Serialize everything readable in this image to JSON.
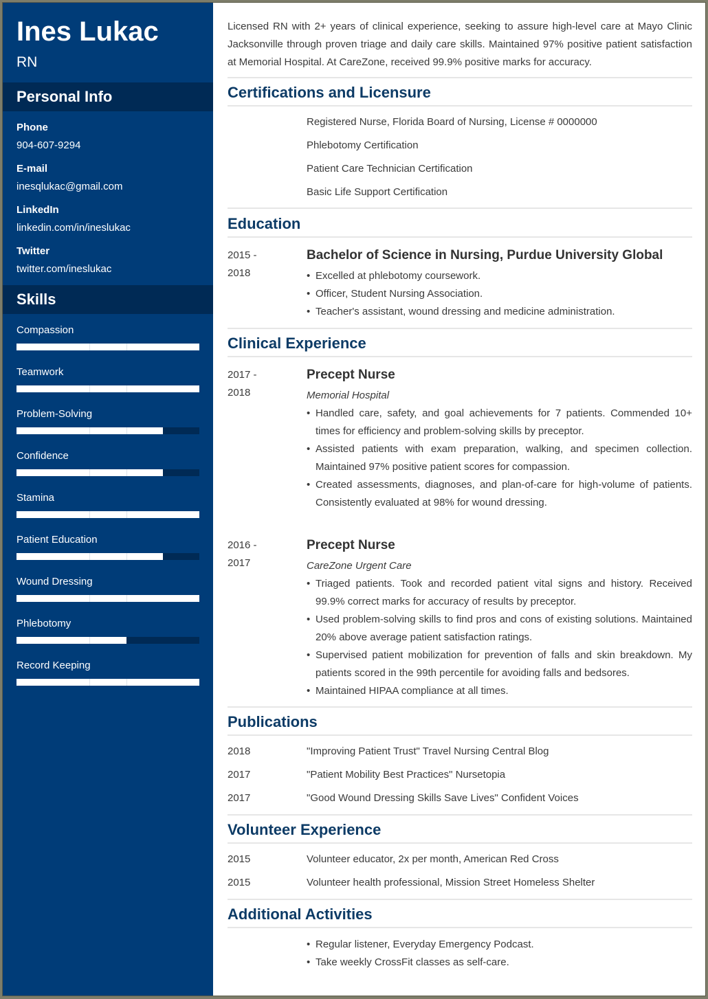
{
  "header": {
    "name": "Ines Lukac",
    "title": "RN"
  },
  "sidebar": {
    "personal_info_title": "Personal Info",
    "contacts": [
      {
        "label": "Phone",
        "value": "904-607-9294"
      },
      {
        "label": "E-mail",
        "value": "inesqlukac@gmail.com"
      },
      {
        "label": "LinkedIn",
        "value": "linkedin.com/in/ineslukac"
      },
      {
        "label": "Twitter",
        "value": "twitter.com/ineslukac"
      }
    ],
    "skills_title": "Skills",
    "skills": [
      {
        "name": "Compassion",
        "level": 1.0
      },
      {
        "name": "Teamwork",
        "level": 1.0
      },
      {
        "name": "Problem-Solving",
        "level": 0.8
      },
      {
        "name": "Confidence",
        "level": 0.8
      },
      {
        "name": "Stamina",
        "level": 1.0
      },
      {
        "name": "Patient Education",
        "level": 0.8
      },
      {
        "name": "Wound Dressing",
        "level": 1.0
      },
      {
        "name": "Phlebotomy",
        "level": 0.6
      },
      {
        "name": "Record Keeping",
        "level": 1.0
      }
    ]
  },
  "summary": "Licensed RN with 2+ years of clinical experience, seeking to assure high-level care at Mayo Clinic Jacksonville through proven triage and daily care skills. Maintained 97% positive patient satisfaction at Memorial Hospital. At CareZone, received 99.9% positive marks for accuracy.",
  "certifications": {
    "title": "Certifications and Licensure",
    "items": [
      "Registered Nurse, Florida Board of Nursing, License # 0000000",
      "Phlebotomy Certification",
      "Patient Care Technician Certification",
      "Basic Life Support Certification"
    ]
  },
  "education": {
    "title": "Education",
    "entries": [
      {
        "start": "2015 -",
        "end": "2018",
        "degree": "Bachelor of Science in Nursing, Purdue University Global",
        "bullets": [
          "Excelled at phlebotomy coursework.",
          "Officer, Student Nursing Association.",
          "Teacher's assistant, wound dressing and medicine administration."
        ]
      }
    ]
  },
  "experience": {
    "title": "Clinical Experience",
    "entries": [
      {
        "start": "2017 -",
        "end": "2018",
        "role": "Precept Nurse",
        "company": "Memorial Hospital",
        "bullets": [
          "Handled care, safety, and goal achievements for 7 patients. Commended 10+ times for efficiency and problem-solving skills by preceptor.",
          "Assisted patients with exam preparation, walking, and specimen collection. Maintained 97% positive patient scores for compassion.",
          "Created assessments, diagnoses, and plan-of-care for high-volume of patients. Consistently evaluated at 98% for wound dressing."
        ]
      },
      {
        "start": "2016 -",
        "end": "2017",
        "role": "Precept Nurse",
        "company": "CareZone Urgent Care",
        "bullets": [
          "Triaged patients. Took and recorded patient vital signs and history. Received 99.9% correct marks for accuracy of results by preceptor.",
          "Used problem-solving skills to find pros and cons of existing solutions. Maintained 20% above average patient satisfaction ratings.",
          "Supervised patient mobilization for prevention of falls and skin breakdown. My patients scored in the 99th percentile for avoiding falls and bedsores.",
          "Maintained HIPAA compliance at all times."
        ]
      }
    ]
  },
  "publications": {
    "title": "Publications",
    "items": [
      {
        "year": "2018",
        "text": "\"Improving Patient Trust\" Travel Nursing Central Blog"
      },
      {
        "year": "2017",
        "text": "\"Patient Mobility Best Practices\" Nursetopia"
      },
      {
        "year": "2017",
        "text": "\"Good Wound Dressing Skills Save Lives\" Confident Voices"
      }
    ]
  },
  "volunteer": {
    "title": "Volunteer Experience",
    "items": [
      {
        "year": "2015",
        "text": "Volunteer educator, 2x per month, American Red Cross"
      },
      {
        "year": "2015",
        "text": "Volunteer health professional, Mission Street Homeless Shelter"
      }
    ]
  },
  "activities": {
    "title": "Additional Activities",
    "items": [
      "Regular listener, Everyday Emergency Podcast.",
      "Take weekly CrossFit classes as self-care."
    ]
  }
}
